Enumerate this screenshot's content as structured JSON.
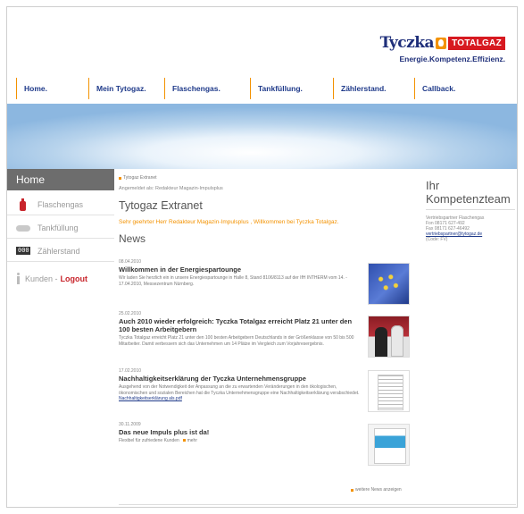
{
  "logo": {
    "brand": "Tyczka",
    "badge": "TOTALGAZ",
    "slogan": "Energie.Kompetenz.Effizienz."
  },
  "nav": [
    "Home.",
    "Mein Tytogaz.",
    "Flaschengas.",
    "Tankfüllung.",
    "Zählerstand.",
    "Callback."
  ],
  "sidebar": {
    "home": "Home",
    "items": [
      "Flaschengas",
      "Tankfüllung",
      "Zählerstand"
    ],
    "kunden": "Kunden -",
    "logout": "Logout"
  },
  "main": {
    "breadcrumb": "Tytogaz Extranet",
    "logged_in_as": "Angemeldet als: Redakteur Magazin-Impulsplus",
    "title": "Tytogaz Extranet",
    "welcome": "Sehr geehrter Herr Redakteur Magazin-Impulsplus , Willkommen bei Tyczka Totalgaz.",
    "news_heading": "News",
    "news": [
      {
        "date": "08.04.2010",
        "headline": "Willkommen in der Energiespartounge",
        "body": "Wir laden Sie herzlich ein in unsere Energiespartounge in Halle 8, Stand 8106/8113 auf der IfH INTHERM vom 14. - 17.04.2010, Messezentrum Nürnberg."
      },
      {
        "date": "25.02.2010",
        "headline": "Auch 2010 wieder erfolgreich: Tyczka Totalgaz erreicht Platz 21 unter den 100 besten Arbeitgebern",
        "body": "Tyczka Totalgaz erreicht Platz 21 unter den 100 besten Arbeitgebern Deutschlands in der Größenklasse von 50 bis 500 Mitarbeiter. Damit verbessern sich das Unternehmen um 14 Plätze im Vergleich zum Vorjahresergebnis."
      },
      {
        "date": "17.02.2010",
        "headline": "Nachhaltigkeitserklärung der Tyczka Unternehmensgruppe",
        "body": "Ausgehend von der Notwendigkeit der Anpassung an die zu erwartenden Veränderungen in den ökologischen, ökonomischen und sozialen Bereichen hat die Tyczka Unternehmensgruppe eine Nachhaltigkeitserklärung verabschiedet.",
        "link": "Nachhaltigkeitserklärung als.pdf"
      },
      {
        "date": "30.11.2009",
        "headline": "Das neue Impuls plus ist da!",
        "body": "Flexibel für zufriedene Kunden",
        "more": "mehr"
      }
    ],
    "more_news": "weitere News anzeigen",
    "top": "top"
  },
  "contact": {
    "title": "Ihr Kompetenzteam",
    "lines": [
      "Vertriebspartner Flaschengas",
      "Fon 08171 627-492",
      "Fax 08171 627-46492"
    ],
    "email": "vertriebspartner@tytogaz.de",
    "code": "(Code: FV)"
  },
  "colors": {
    "accent": "#f39200",
    "brand_blue": "#1f2f7a",
    "brand_red": "#d71920"
  }
}
